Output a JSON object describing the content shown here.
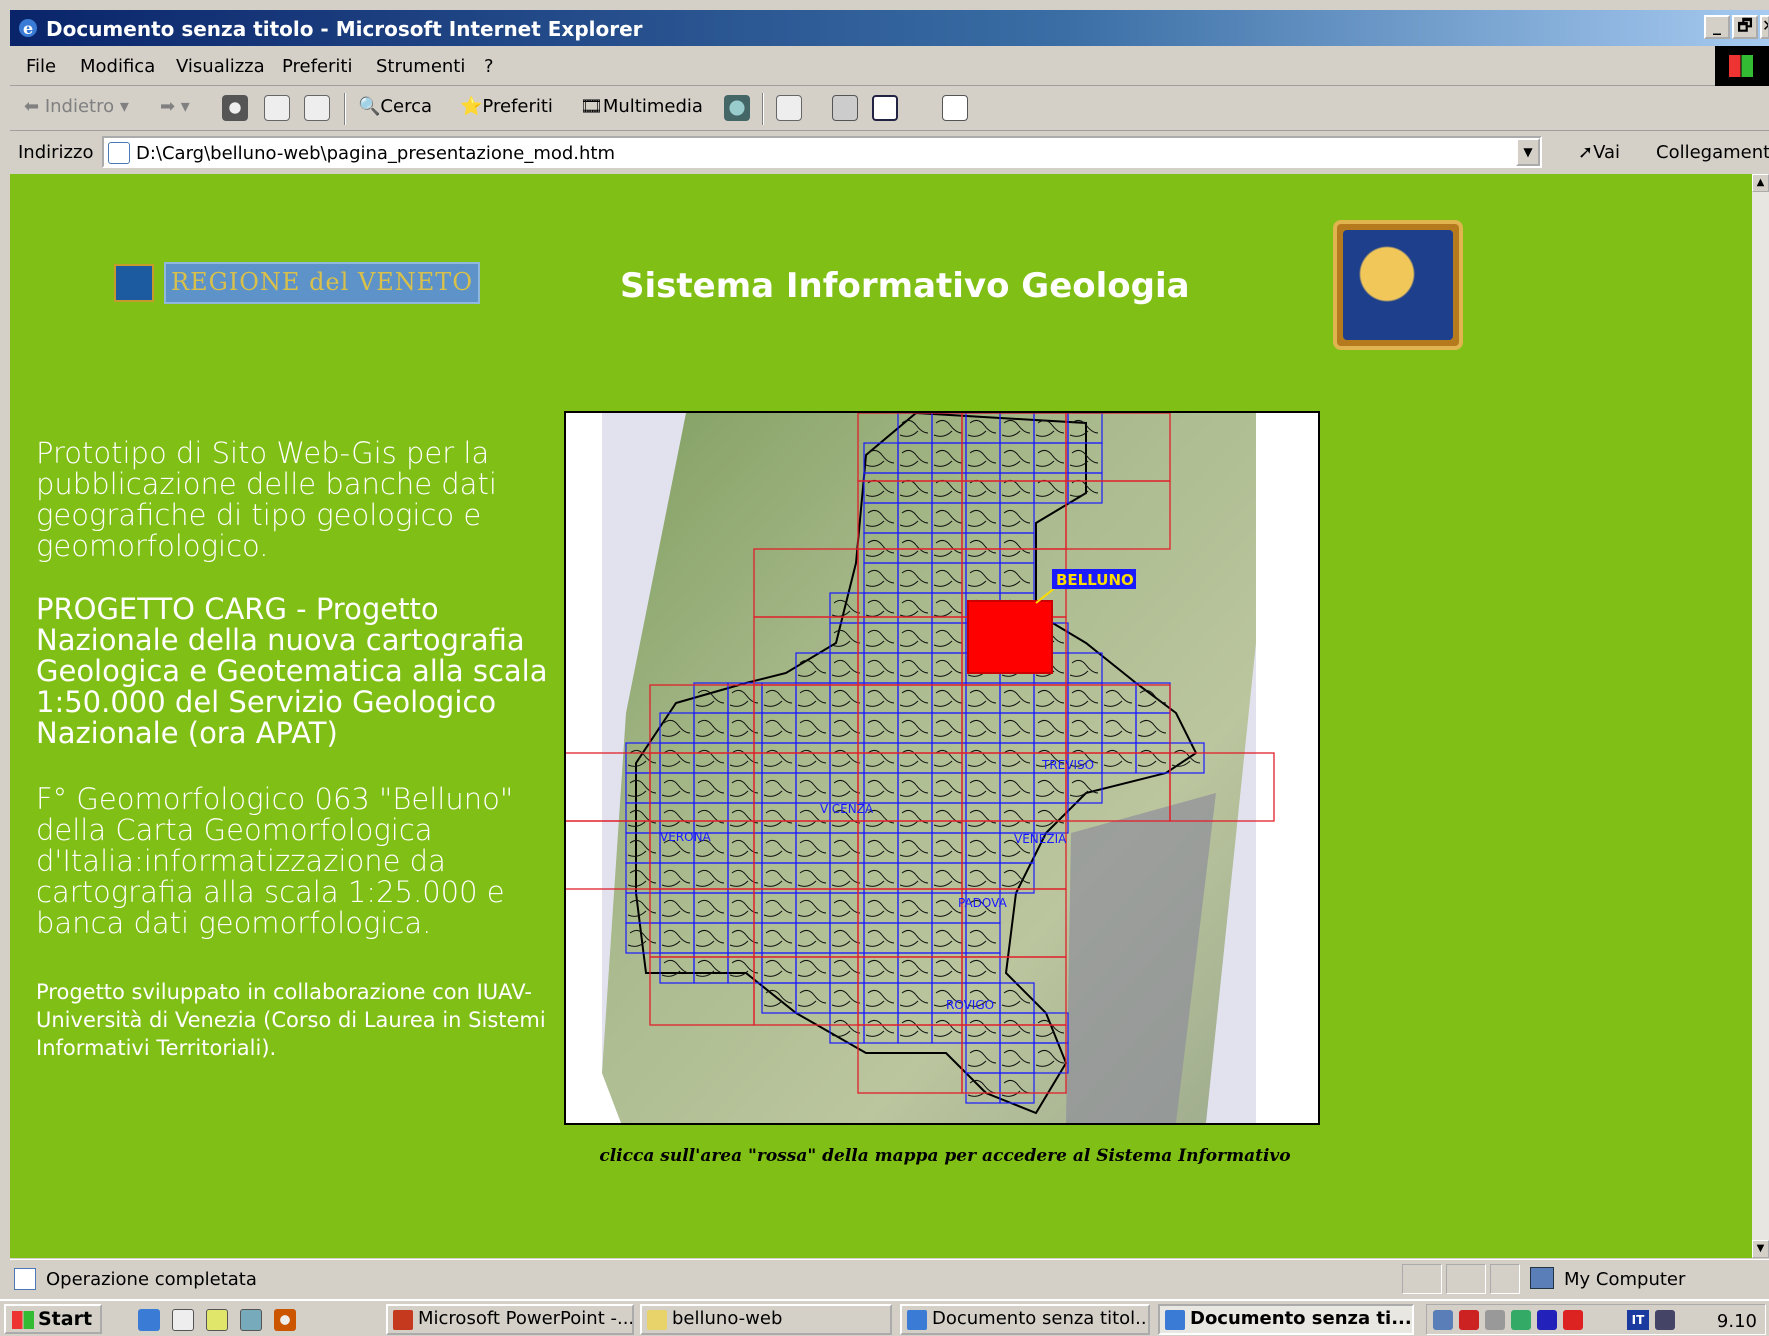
{
  "window": {
    "title": "Documento senza titolo - Microsoft Internet Explorer",
    "controls": [
      "_",
      "🗗",
      "✕"
    ]
  },
  "menu": [
    "File",
    "Modifica",
    "Visualizza",
    "Preferiti",
    "Strumenti",
    "?"
  ],
  "toolbar": {
    "back_label": "Indietro",
    "search_label": "Cerca",
    "favorites_label": "Preferiti",
    "media_label": "Multimedia"
  },
  "address": {
    "label": "Indirizzo",
    "url": "D:\\Carg\\belluno-web\\pagina_presentazione_mod.htm",
    "go_label": "Vai",
    "links_label": "Collegamenti"
  },
  "page": {
    "logo_text": "REGIONE del VENETO",
    "title": "Sistema Informativo Geologia",
    "intro": "Prototipo di Sito Web-Gis per la pubblicazione delle banche dati geografiche di tipo geologico e geomorfologico.",
    "carg": "PROGETTO CARG - Progetto Nazionale della nuova cartografia Geologica e Geotematica alla scala 1:50.000 del Servizio Geologico Nazionale (ora APAT)",
    "foglio": "F° Geomorfologico 063 \"Belluno\" della Carta Geomorfologica d'Italia:informatizzazione da cartografia alla scala 1:25.000 e banca dati geomorfologica.",
    "collab": "Progetto sviluppato in collaborazione con IUAV- Università di Venezia (Corso di Laurea in Sistemi Informativi Territoriali).",
    "map_caption": "clicca sull'area \"rossa\" della mappa per accedere al Sistema Informativo",
    "map_labels": {
      "belluno": "BELLUNO",
      "treviso": "TREVISO",
      "vicenza": "VICENZA",
      "verona": "VERONA",
      "venezia": "VENEZIA",
      "padova": "PADOVA",
      "rovigo": "ROVIGO"
    },
    "colors": {
      "background": "#80bf15",
      "selected_area": "#ff0000",
      "sheet_grid": "#e0202a",
      "subsheet_grid": "#1a1aff"
    }
  },
  "status": {
    "text": "Operazione completata",
    "zone": "My Computer"
  },
  "taskbar": {
    "start": "Start",
    "tasks": [
      "Microsoft PowerPoint -...",
      "belluno-web",
      "Documento senza titol...",
      "Documento senza ti..."
    ],
    "language": "IT",
    "clock": "9.10"
  }
}
